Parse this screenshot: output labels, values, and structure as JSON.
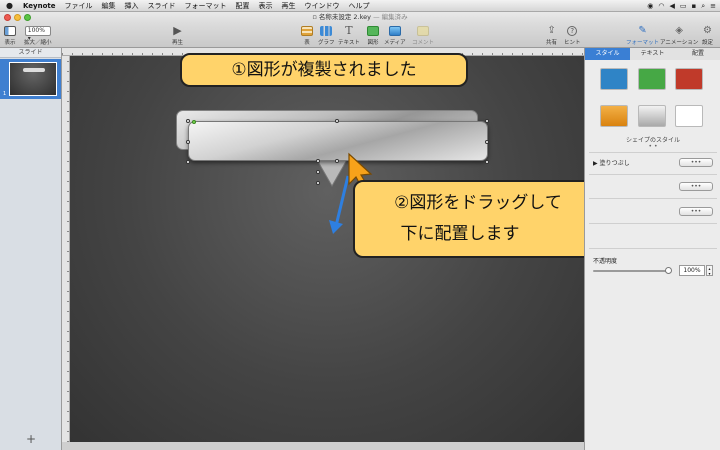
{
  "menubar": {
    "app_name": "Keynote",
    "items": [
      "ファイル",
      "編集",
      "挿入",
      "スライド",
      "フォーマット",
      "配置",
      "表示",
      "再生",
      "ウインドウ",
      "ヘルプ"
    ]
  },
  "window": {
    "title": "名称未設定 2.key",
    "status": "— 編集済み"
  },
  "toolbar": {
    "view_label": "表示",
    "zoom_value": "100%",
    "zoom_label": "拡大／縮小",
    "play_label": "再生",
    "table_label": "表",
    "chart_label": "グラフ",
    "text_label": "テキスト",
    "shape_label": "図形",
    "media_label": "メディア",
    "comment_label": "コメント",
    "share_label": "共有",
    "tips_label": "ヒント",
    "format_label": "フォーマット",
    "animate_label": "アニメーション",
    "setup_label": "設定"
  },
  "sidebar": {
    "header": "スライド",
    "slide_number": "1",
    "add_label": "+"
  },
  "callouts": {
    "first": "①図形が複製されました",
    "second_line1": "②図形をドラッグして",
    "second_line2": "下に配置します"
  },
  "inspector": {
    "tabs": [
      "スタイル",
      "テキスト",
      "配置"
    ],
    "swatch_colors": [
      "#2f84c6",
      "#46a845",
      "#c03a2a",
      "#e8961e",
      "#cfcfcf",
      "#ffffff"
    ],
    "shape_style_label": "シェイプのスタイル",
    "fill_label": "塗りつぶし",
    "opacity_label": "不透明度",
    "opacity_value": "100%",
    "more_label": "•••"
  }
}
